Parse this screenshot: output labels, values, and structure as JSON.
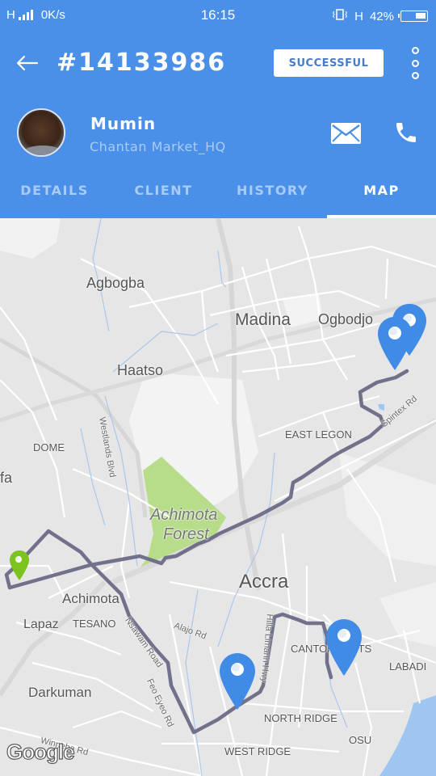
{
  "status_bar": {
    "network_type": "H",
    "data_rate": "0K/s",
    "time": "16:15",
    "vibrate_icon": "vibrate-icon",
    "network_type_right": "H",
    "battery_percent": "42%",
    "battery_level": 0.42
  },
  "header": {
    "back_icon": "arrow-left-icon",
    "order_id": "#14133986",
    "status": "SUCCESSFUL",
    "more_icon": "more-vertical-icon"
  },
  "user": {
    "name": "Mumin",
    "location": "Chantan Market_HQ",
    "mail_icon": "mail-icon",
    "phone_icon": "phone-icon"
  },
  "tabs": [
    {
      "label": "DETAILS",
      "active": false
    },
    {
      "label": "CLIENT",
      "active": false
    },
    {
      "label": "HISTORY",
      "active": false
    },
    {
      "label": "MAP",
      "active": true
    }
  ],
  "map": {
    "attribution": "Google",
    "colors": {
      "header": "#4a90e8",
      "route": "#6b6a86",
      "pin_blue": "#3f8be6",
      "pin_green": "#7cc320",
      "forest": "#b7dc8a",
      "water": "#9ec6f0",
      "land": "#e6e6e6"
    },
    "place_labels": {
      "agbogba": "Agbogba",
      "madina": "Madina",
      "ogbodjo": "Ogbodjo",
      "haatso": "Haatso",
      "dome": "DOME",
      "east_legon": "EAST LEGON",
      "fa": "fa",
      "achimota_forest_1": "Achimota",
      "achimota_forest_2": "Forest",
      "accra": "Accra",
      "achimota": "Achimota",
      "lapaz": "Lapaz",
      "tesano": "TESANO",
      "cantonments": "CANTONMENTS",
      "labadi": "LABADI",
      "darkuman": "Darkuman",
      "north_ridge": "NORTH RIDGE",
      "osu": "OSU",
      "west_ridge": "WEST RIDGE"
    },
    "road_labels": {
      "westlands": "Westlands Blvd",
      "spintex": "Spintex Rd",
      "nsawam": "Nsawam Road",
      "alajo": "Alajo Rd",
      "hilla": "Hilla Limann Hwy",
      "feo_eyeo": "Feo Eyeo Rd",
      "winneba": "Winneba Rd"
    },
    "markers": [
      {
        "type": "start",
        "color": "green"
      },
      {
        "type": "stop",
        "color": "blue"
      },
      {
        "type": "stop",
        "color": "blue"
      },
      {
        "type": "stop",
        "color": "blue"
      },
      {
        "type": "stop",
        "color": "blue"
      }
    ]
  }
}
